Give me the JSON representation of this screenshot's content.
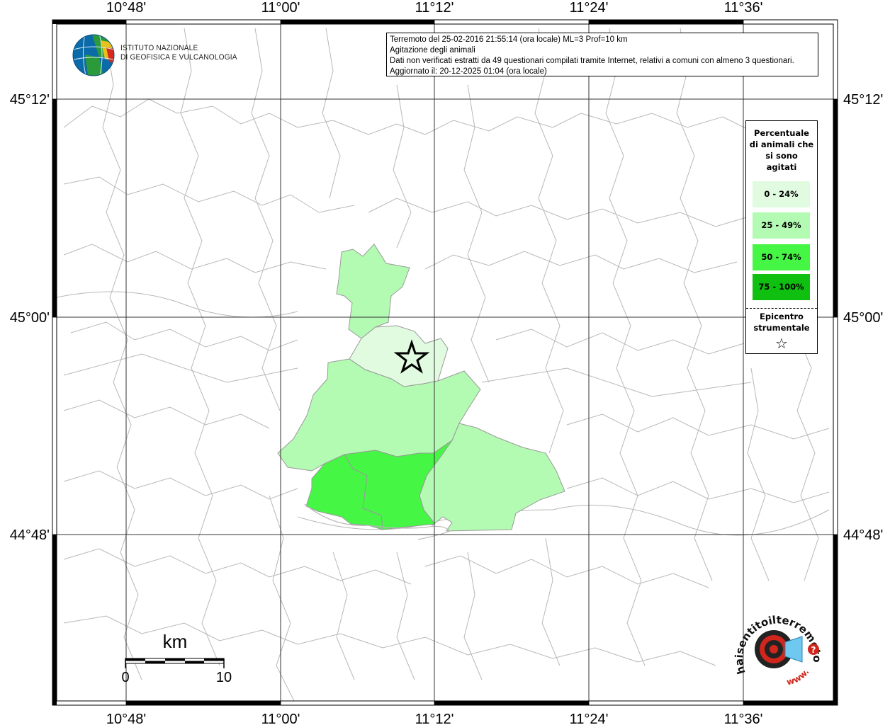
{
  "info": {
    "line1": "Terremoto del 25-02-2016 21:55:14 (ora locale) ML=3 Prof=10 km",
    "line2": "Agitazione degli animali",
    "line3": "Dati non verificati estratti da 49 questionari compilati tramite Internet, relativi a comuni con almeno 3 questionari.",
    "line4": "Aggiornato il: 20-12-2025 01:04 (ora locale)"
  },
  "logo": {
    "name_line1": "ISTITUTO NAZIONALE",
    "name_line2": "DI GEOFISICA E VULCANOLOGIA",
    "colors": [
      "#0b6aa8",
      "#2a9a3a",
      "#e8c11a",
      "#d62a1e"
    ]
  },
  "axes": {
    "top_labels": [
      "10°48'",
      "11°00'",
      "11°12'",
      "11°24'",
      "11°36'"
    ],
    "bottom_labels": [
      "10°48'",
      "11°00'",
      "11°12'",
      "11°24'",
      "11°36'"
    ],
    "left_labels": [
      "45°12'",
      "45°00'",
      "44°48'"
    ],
    "right_labels": [
      "45°12'",
      "45°00'",
      "44°48'"
    ]
  },
  "legend": {
    "title": "Percentuale di animali che si sono agitati",
    "items": [
      {
        "label": "0 - 24%",
        "color": "#e0fbe0"
      },
      {
        "label": "25 - 49%",
        "color": "#b3fbb3"
      },
      {
        "label": "50 - 74%",
        "color": "#45f645"
      },
      {
        "label": "75 - 100%",
        "color": "#10c010"
      }
    ],
    "epicenter_label": "Epicentro strumentale",
    "epicenter_symbol": "☆"
  },
  "scalebar": {
    "unit": "km",
    "start": "0",
    "end": "10"
  },
  "badge": {
    "text": "haisentitoilterremoto.it",
    "url_text": "www.",
    "question": "?",
    "color": "#d0261c"
  }
}
